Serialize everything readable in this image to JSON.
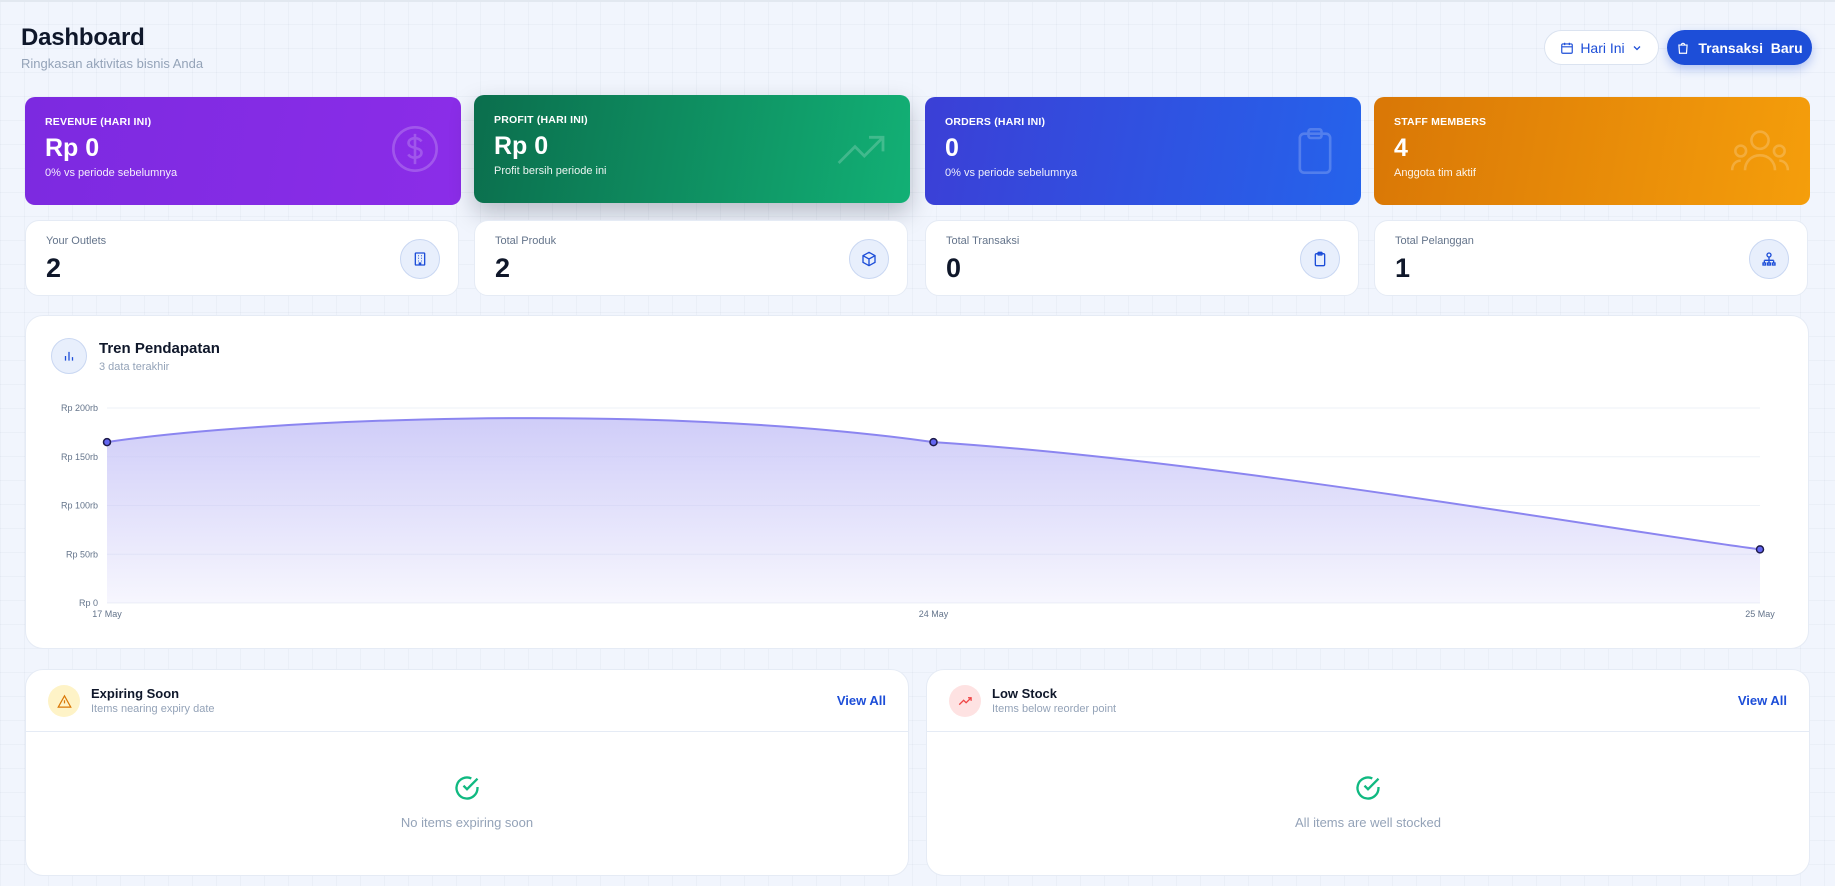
{
  "header": {
    "title": "Dashboard",
    "subtitle": "Ringkasan aktivitas bisnis Anda",
    "period_label": "Hari Ini",
    "new_transaction_label": "Transaksi  Baru"
  },
  "stat_cards": [
    {
      "label": "REVENUE (HARI INI)",
      "value": "Rp 0",
      "sub": "0% vs periode sebelumnya",
      "icon": "dollar-icon",
      "color": "#7c2ae0"
    },
    {
      "label": "PROFIT (HARI INI)",
      "value": "Rp 0",
      "sub": "Profit bersih periode ini",
      "icon": "trending-up-icon",
      "color": "#0f9f6a"
    },
    {
      "label": "ORDERS (HARI INI)",
      "value": "0",
      "sub": "0% vs periode sebelumnya",
      "icon": "clipboard-icon",
      "color": "#3b3fd6"
    },
    {
      "label": "STAFF MEMBERS",
      "value": "4",
      "sub": "Anggota tim aktif",
      "icon": "users-icon",
      "color": "#e58a0a"
    }
  ],
  "mini_cards": [
    {
      "label": "Your Outlets",
      "value": "2",
      "icon": "building-icon"
    },
    {
      "label": "Total Produk",
      "value": "2",
      "icon": "box-icon"
    },
    {
      "label": "Total Transaksi",
      "value": "0",
      "icon": "clipboard-icon"
    },
    {
      "label": "Total Pelanggan",
      "value": "1",
      "icon": "network-icon"
    }
  ],
  "revenue_chart": {
    "title": "Tren Pendapatan",
    "subtitle": "3 data terakhir",
    "icon": "bar-chart-icon"
  },
  "chart_data": {
    "type": "area",
    "title": "Tren Pendapatan",
    "x": [
      "17 May",
      "24 May",
      "25 May"
    ],
    "series": [
      {
        "values": [
          165000,
          165000,
          55000
        ]
      }
    ],
    "ylim": [
      0,
      200000
    ],
    "yticks": [
      0,
      50000,
      100000,
      150000,
      200000
    ],
    "ytick_labels": [
      "Rp 0",
      "Rp 50rb",
      "Rp 100rb",
      "Rp 150rb",
      "Rp 200rb"
    ],
    "grid": true,
    "line_color": "#8b85f0",
    "fill_color": "#c7c4f7",
    "point_color": "#1e1b4b"
  },
  "panels": [
    {
      "title": "Expiring Soon",
      "subtitle": "Items nearing expiry date",
      "view_all": "View All",
      "empty_message": "No items expiring soon",
      "icon": "warning-icon"
    },
    {
      "title": "Low Stock",
      "subtitle": "Items below reorder point",
      "view_all": "View All",
      "empty_message": "All items are well stocked",
      "icon": "trend-down-icon"
    }
  ],
  "colors": {
    "primary": "#1d4ed8",
    "success": "#10b981",
    "warning": "#f59e0b",
    "danger": "#ef4444"
  }
}
